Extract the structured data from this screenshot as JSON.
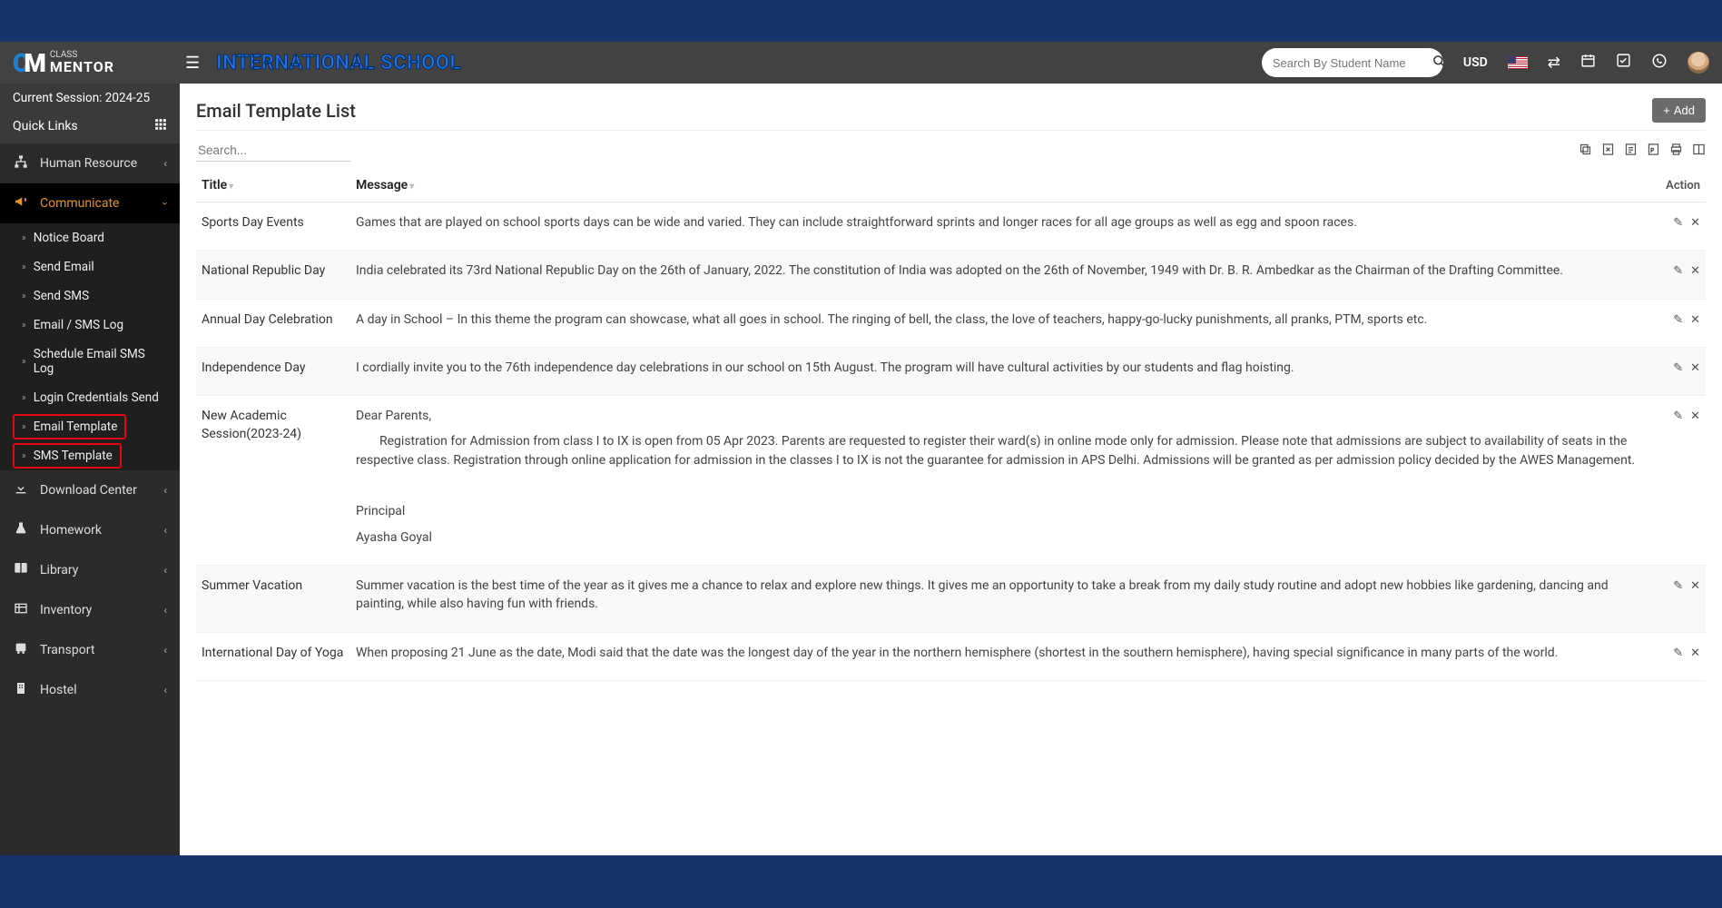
{
  "header": {
    "school_name": "INTERNATIONAL SCHOOL",
    "search_placeholder": "Search By Student Name",
    "currency": "USD"
  },
  "sidebar": {
    "session": "Current Session: 2024-25",
    "quick_links": "Quick Links",
    "items": [
      {
        "label": "Human Resource",
        "icon": "sitemap"
      },
      {
        "label": "Communicate",
        "icon": "bullhorn",
        "active": true
      },
      {
        "label": "Download Center",
        "icon": "download"
      },
      {
        "label": "Homework",
        "icon": "flask"
      },
      {
        "label": "Library",
        "icon": "book"
      },
      {
        "label": "Inventory",
        "icon": "inventory"
      },
      {
        "label": "Transport",
        "icon": "bus"
      },
      {
        "label": "Hostel",
        "icon": "building"
      }
    ],
    "communicate_sub": [
      "Notice Board",
      "Send Email",
      "Send SMS",
      "Email / SMS Log",
      "Schedule Email SMS Log",
      "Login Credentials Send",
      "Email Template",
      "SMS Template"
    ]
  },
  "page": {
    "title": "Email Template List",
    "add_button": "Add",
    "search_placeholder": "Search...",
    "columns": {
      "title": "Title",
      "message": "Message",
      "action": "Action"
    }
  },
  "templates": [
    {
      "title": "Sports Day Events",
      "message": [
        "Games that are played on school sports days can be wide and varied. They can include straightforward sprints and longer races for all age groups as well as egg and spoon races."
      ]
    },
    {
      "title": "National Republic Day",
      "message": [
        "India celebrated its 73rd National Republic Day on the 26th of January, 2022. The constitution of India was adopted on the 26th of November, 1949 with Dr. B. R. Ambedkar as the Chairman of the Drafting Committee."
      ]
    },
    {
      "title": "Annual Day Celebration",
      "message": [
        "A day in School – In this theme the program can showcase, what all goes in school. The ringing of bell, the class, the love of teachers, happy-go-lucky punishments, all pranks, PTM, sports etc."
      ]
    },
    {
      "title": "Independence Day",
      "message": [
        "I cordially invite you to the 76th independence day celebrations in our school on 15th August. The program will have cultural activities by our students and flag hoisting."
      ]
    },
    {
      "title": "New Academic Session(2023-24)",
      "message": [
        "Dear Parents,",
        "Registration for Admission from class I to IX is open from 05 Apr 2023. Parents are requested to register their ward(s) in online mode only for admission. Please note that admissions are subject to availability of seats in the respective class. Registration through online application for admission in the classes I to IX is not the guarantee for admission in APS Delhi. Admissions will be granted as per admission policy decided by the AWES Management.",
        "",
        "Principal",
        "Ayasha Goyal"
      ]
    },
    {
      "title": "Summer Vacation",
      "message": [
        "Summer vacation is the best time of the year as it gives me a chance to relax and explore new things. It gives me an opportunity to take a break from my daily study routine and adopt new hobbies like gardening, dancing and painting, while also having fun with friends."
      ]
    },
    {
      "title": "International Day of Yoga",
      "message": [
        "When proposing 21 June as the date, Modi said that the date was the longest day of the year in the northern hemisphere (shortest in the southern hemisphere), having special significance in many parts of the world."
      ]
    }
  ]
}
